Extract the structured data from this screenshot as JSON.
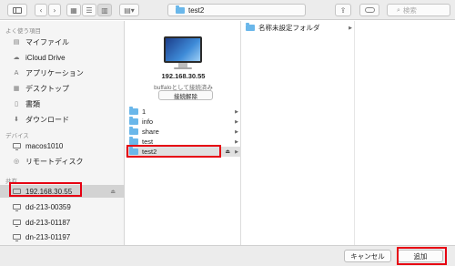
{
  "toolbar": {
    "sidebar_toggle_icon": "sidebar-icon",
    "back_icon": "‹",
    "forward_icon": "›",
    "location": "test2",
    "search_placeholder": "検索",
    "share_icon": "share-icon",
    "tag_icon": "tag-icon"
  },
  "sidebar": {
    "favorites_header": "よく使う項目",
    "favorites": [
      {
        "label": "マイファイル",
        "icon": "all-files-icon"
      },
      {
        "label": "iCloud Drive",
        "icon": "cloud-icon"
      },
      {
        "label": "アプリケーション",
        "icon": "applications-icon"
      },
      {
        "label": "デスクトップ",
        "icon": "desktop-icon"
      },
      {
        "label": "書類",
        "icon": "document-icon"
      },
      {
        "label": "ダウンロード",
        "icon": "download-icon"
      }
    ],
    "devices_header": "デバイス",
    "devices": [
      {
        "label": "macos1010",
        "icon": "computer-icon"
      },
      {
        "label": "リモートディスク",
        "icon": "disc-icon"
      }
    ],
    "shared_header": "共有",
    "shared": [
      {
        "label": "192.168.30.55",
        "icon": "server-icon",
        "selected": true
      },
      {
        "label": "dd-213-00359",
        "icon": "server-icon"
      },
      {
        "label": "dd-213-01187",
        "icon": "server-icon"
      },
      {
        "label": "dn-213-01197",
        "icon": "server-icon"
      }
    ]
  },
  "server": {
    "name": "192.168.30.55",
    "status": "buffaloとして接続済み",
    "disconnect_label": "接続解除"
  },
  "shares": [
    {
      "label": "1"
    },
    {
      "label": "info"
    },
    {
      "label": "share"
    },
    {
      "label": "test"
    },
    {
      "label": "test2",
      "selected": true
    }
  ],
  "subfolders": [
    {
      "label": "名称未設定フォルダ"
    }
  ],
  "buttons": {
    "cancel": "キャンセル",
    "add": "追加"
  },
  "colors": {
    "highlight": "#e60012",
    "folder": "#6ab7ea"
  }
}
